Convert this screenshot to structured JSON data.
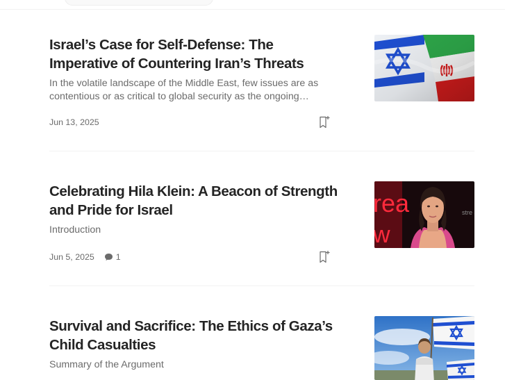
{
  "articles": [
    {
      "title": "Israel’s Case for Self-Defense: The Imperative of Countering Iran’s Threats",
      "subtitle": "In the volatile landscape of the Middle East, few issues are as contentious or as critical to global security as the ongoing…",
      "date": "Jun 13, 2025",
      "thumbnail": "israel-iran-flags"
    },
    {
      "title": "Celebrating Hila Klein: A Beacon of Strength and Pride for Israel",
      "subtitle": "Introduction",
      "date": "Jun 5, 2025",
      "responses": "1",
      "thumbnail": "woman-portrait-event",
      "thumb_text_left": "rea",
      "thumb_text_right": "stre awa"
    },
    {
      "title": "Survival and Sacrifice: The Ethics of Gaza’s Child Casualties",
      "subtitle": "Summary of the Argument",
      "thumbnail": "child-with-israeli-flags"
    }
  ],
  "icons": {
    "save": "bookmark-plus-icon",
    "responses": "speech-bubble-icon"
  },
  "colors": {
    "title": "#242424",
    "muted": "#6b6b6b",
    "divider": "#f2f2f2",
    "israel_blue": "#0038b8",
    "iran_green": "#239f40",
    "iran_red": "#da0000"
  }
}
